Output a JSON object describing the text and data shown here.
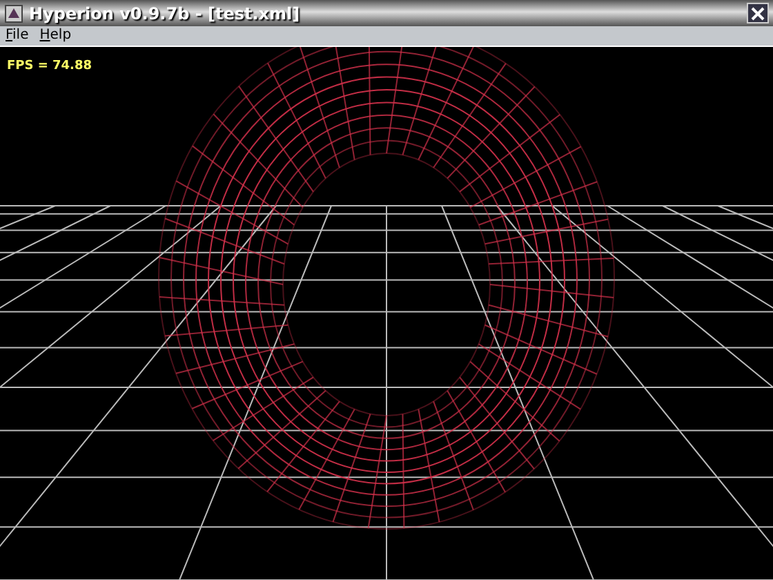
{
  "window": {
    "title": "Hyperion v0.9.7b - [test.xml]"
  },
  "menu": [
    "File",
    "Help"
  ],
  "viewport": {
    "fps": "FPS = 74.88"
  }
}
